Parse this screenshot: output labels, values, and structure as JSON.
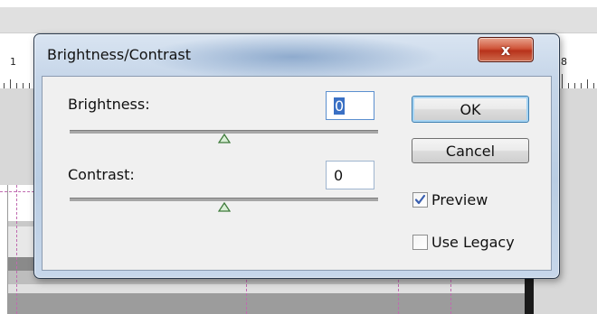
{
  "dialog": {
    "title": "Brightness/Contrast",
    "close_label": "x"
  },
  "brightness": {
    "label": "Brightness:",
    "value": "0",
    "slider_level": 0.5
  },
  "contrast": {
    "label": "Contrast:",
    "value": "0",
    "slider_level": 0.5
  },
  "buttons": {
    "ok": "OK",
    "cancel": "Cancel"
  },
  "options": {
    "preview": {
      "label": "Preview",
      "checked": true
    },
    "use_legacy": {
      "label": "Use Legacy",
      "checked": false
    }
  },
  "background": {
    "ruler_numbers": {
      "left": "1",
      "right": "8"
    }
  },
  "colors": {
    "thumb_fill": "#d9eed6",
    "thumb_stroke": "#3e7a3a",
    "check_mark": "#3a5fb0",
    "selection": "#3a70c4"
  }
}
